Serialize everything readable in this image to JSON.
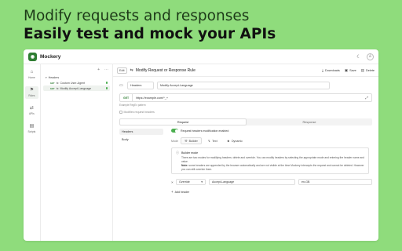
{
  "hero": {
    "line1": "Modify requests and responses",
    "line2": "Easily test and mock your APIs"
  },
  "app": {
    "title": "Mockery",
    "theme_icon": "moon-icon",
    "user_icon": "user-icon"
  },
  "rail": [
    {
      "icon": "⌂",
      "label": "Home"
    },
    {
      "icon": "⚑",
      "label": "Rules"
    },
    {
      "icon": "⇄",
      "label": "APIs"
    },
    {
      "icon": "▤",
      "label": "Scripts"
    }
  ],
  "tree": {
    "folder": "Headers",
    "items": [
      {
        "method": "GET",
        "label": "Custom User-Agent"
      },
      {
        "method": "GET",
        "label": "Modify Accept-Language"
      }
    ]
  },
  "rule": {
    "edit_badge": "Edit",
    "title": "Modify Request or Response Rule",
    "actions": {
      "downloads": "Downloads",
      "save": "Save",
      "delete": "Delete"
    },
    "folder_value": "Headers",
    "name_value": "Modify Accept-Language",
    "method": "GET",
    "url": "https://example.com/*_+",
    "hint": "Example RegEx pattern",
    "modifies_label": "Modifies request headers"
  },
  "tabs": {
    "request": "Request",
    "response": "Response"
  },
  "subnav": {
    "headers": "Headers",
    "body": "Body"
  },
  "pane": {
    "toggle_label": "Request headers modification enabled",
    "mode_label": "Mode",
    "modes": [
      "Builder",
      "Text",
      "Dynamic"
    ],
    "info_title": "Builder mode",
    "info_p1": "There are two modes for modifying headers: delete and override. You can modify headers by selecting the appropriate mode and entering the header name and value.",
    "info_note_label": "Note:",
    "info_p2": "some headers are appended by the browser automatically and are not visible at the time Mockery intercepts the request and cannot be deleted. However you can still override them.",
    "header_row": {
      "mode": "Override",
      "name": "Accept-Language",
      "value": "en-GB"
    },
    "add_header": "Add header"
  },
  "colors": {
    "background": "#8fdc7c",
    "accent": "#4caf50"
  }
}
